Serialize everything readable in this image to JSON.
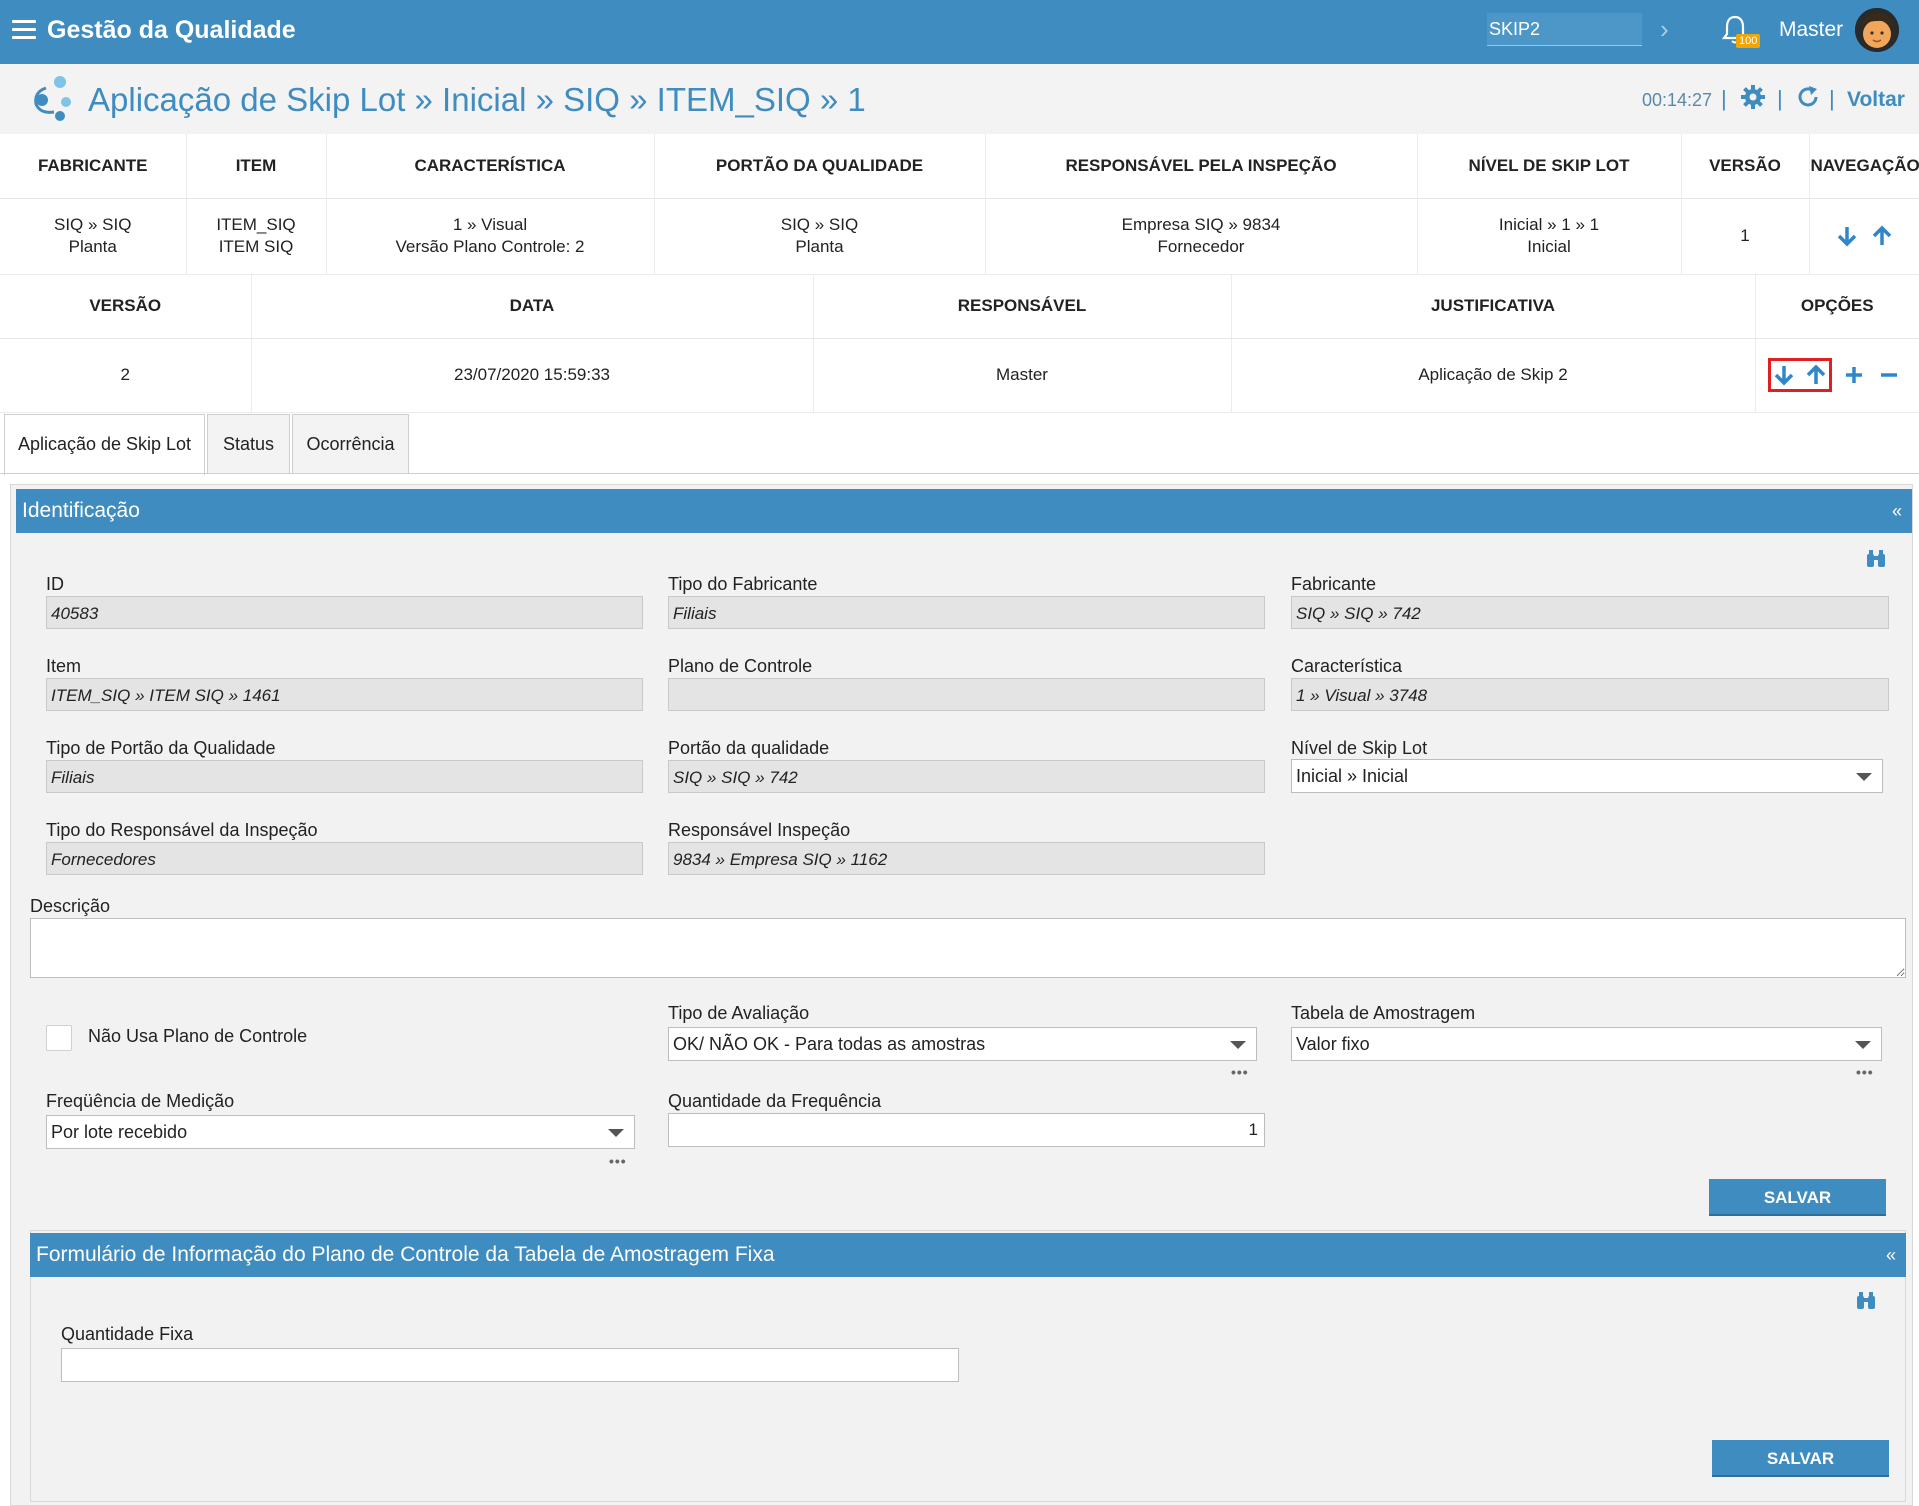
{
  "topbar": {
    "title": "Gestão da Qualidade",
    "search_value": "SKIP2",
    "notification_count": "100",
    "user_name": "Master"
  },
  "header": {
    "breadcrumb": "Aplicação de Skip Lot » Inicial » SIQ » ITEM_SIQ » 1",
    "timer": "00:14:27",
    "back_label": "Voltar"
  },
  "summary_table": {
    "columns": [
      "FABRICANTE",
      "ITEM",
      "CARACTERÍSTICA",
      "PORTÃO DA QUALIDADE",
      "RESPONSÁVEL PELA INSPEÇÃO",
      "NÍVEL DE SKIP LOT",
      "VERSÃO",
      "NAVEGAÇÃO"
    ],
    "row": {
      "fabricante_1": "SIQ » SIQ",
      "fabricante_2": "Planta",
      "item_1": "ITEM_SIQ",
      "item_2": "ITEM SIQ",
      "caracteristica_1": "1 » Visual",
      "caracteristica_2": "Versão Plano Controle: 2",
      "portao_1": "SIQ » SIQ",
      "portao_2": "Planta",
      "responsavel_1": "Empresa SIQ » 9834",
      "responsavel_2": "Fornecedor",
      "nivel_1": "Inicial » 1 » 1",
      "nivel_2": "Inicial",
      "versao": "1"
    }
  },
  "version_table": {
    "columns": [
      "VERSÃO",
      "DATA",
      "RESPONSÁVEL",
      "JUSTIFICATIVA",
      "OPÇÕES"
    ],
    "row": {
      "versao": "2",
      "data": "23/07/2020 15:59:33",
      "responsavel": "Master",
      "justificativa": "Aplicação de Skip 2"
    }
  },
  "tabs": [
    "Aplicação de Skip Lot",
    "Status",
    "Ocorrência"
  ],
  "identificacao": {
    "title": "Identificação",
    "collapse_glyph": "«",
    "fields": {
      "id_label": "ID",
      "id_value": "40583",
      "tipo_fabricante_label": "Tipo do Fabricante",
      "tipo_fabricante_value": "Filiais",
      "fabricante_label": "Fabricante",
      "fabricante_value": "SIQ » SIQ » 742",
      "item_label": "Item",
      "item_value": "ITEM_SIQ » ITEM SIQ » 1461",
      "plano_label": "Plano de Controle",
      "plano_value": "",
      "caracteristica_label": "Característica",
      "caracteristica_value": "1 » Visual » 3748",
      "tipo_portao_label": "Tipo de Portão da Qualidade",
      "tipo_portao_value": "Filiais",
      "portao_label": "Portão da qualidade",
      "portao_value": "SIQ » SIQ » 742",
      "nivel_label": "Nível de Skip Lot",
      "nivel_value": "Inicial » Inicial",
      "tipo_resp_label": "Tipo do Responsável da Inspeção",
      "tipo_resp_value": "Fornecedores",
      "resp_label": "Responsável Inspeção",
      "resp_value": "9834 » Empresa SIQ » 1162",
      "descricao_label": "Descrição",
      "descricao_value": "",
      "nao_usa_plano_label": "Não Usa Plano de Controle",
      "tipo_avaliacao_label": "Tipo de Avaliação",
      "tipo_avaliacao_value": "OK/ NÃO OK - Para todas as amostras",
      "tabela_amostragem_label": "Tabela de Amostragem",
      "tabela_amostragem_value": "Valor fixo",
      "frequencia_label": "Freqüência de Medição",
      "frequencia_value": "Por lote recebido",
      "qtd_frequencia_label": "Quantidade da Frequência",
      "qtd_frequencia_value": "1",
      "more_glyph": "•••"
    },
    "save_label": "SALVAR"
  },
  "formulario": {
    "title": "Formulário de Informação do Plano de Controle da Tabela de Amostragem Fixa",
    "collapse_glyph": "«",
    "qtd_fixa_label": "Quantidade Fixa",
    "qtd_fixa_value": "",
    "save_label": "SALVAR"
  },
  "colors": {
    "primary": "#3f8cc0",
    "highlight": "#e02020"
  }
}
